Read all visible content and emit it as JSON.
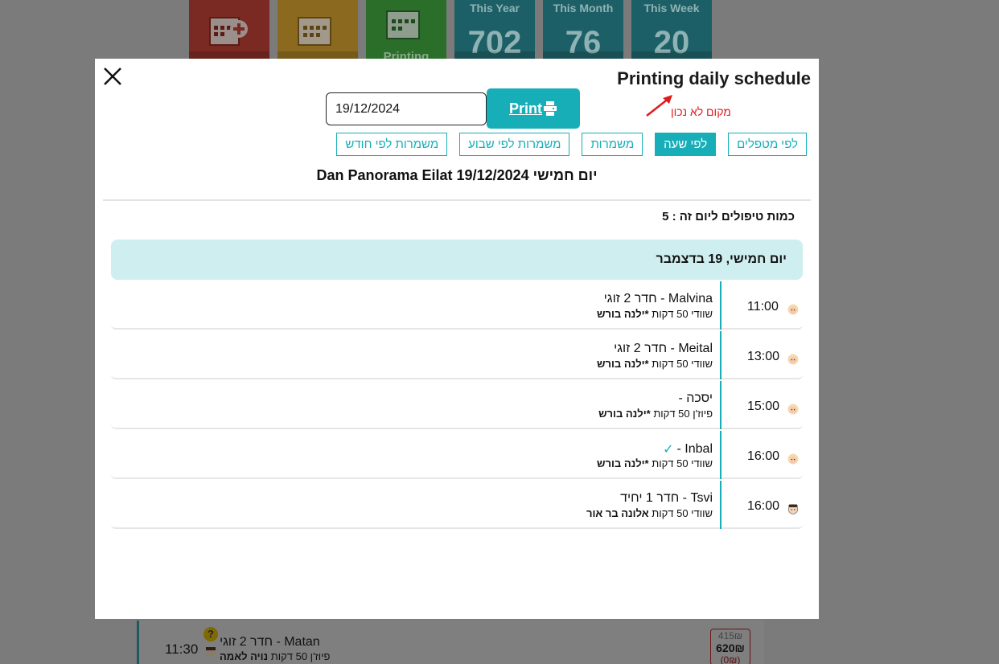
{
  "background": {
    "tiles": [
      {
        "color": "red",
        "icon": "calendar-plus-icon"
      },
      {
        "color": "orange",
        "icon": "calendar-icon"
      },
      {
        "color": "green",
        "icon": "calendar-print-icon",
        "label": "Printing"
      },
      {
        "color": "teal",
        "caption": "This Year",
        "value": "702"
      },
      {
        "color": "teal",
        "caption": "This Month",
        "value": "76"
      },
      {
        "color": "teal",
        "caption": "This Week",
        "value": "20"
      }
    ],
    "row": {
      "time": "11:30",
      "name": "Matan - חדר 2 זוגי",
      "sub_prefix": "פיוז'ן 50 דקות",
      "sub_bold": "נויה לאמה",
      "price_old": "415₪",
      "price": "620₪",
      "price_extra": "(0₪)"
    }
  },
  "modal": {
    "title": "Printing daily schedule",
    "date_value": "19/12/2024",
    "print_label": "Print",
    "annotation": "מקום לא נכון",
    "tabs": [
      "לפי מטפלים",
      "לפי שעה",
      "משמרות",
      "משמרות לפי שבוע",
      "משמרות לפי חודש"
    ],
    "active_tab": "לפי שעה",
    "schedule_title": "Dan Panorama Eilat יום חמישי 19/12/2024",
    "count_text": "כמות טיפולים ליום זה : 5",
    "day_header": "יום חמישי, 19 בדצמבר",
    "appointments": [
      {
        "time": "11:00",
        "name": "Malvina - חדר 2 זוגי",
        "sub_prefix": "שוודי 50 דקות",
        "therapist": "*ילנה בורש",
        "checked": false,
        "avatar": "female"
      },
      {
        "time": "13:00",
        "name": "Meital - חדר 2 זוגי",
        "sub_prefix": "שוודי 50 דקות",
        "therapist": "*ילנה בורש",
        "checked": false,
        "avatar": "female"
      },
      {
        "time": "15:00",
        "name": "יסכה -",
        "sub_prefix": "פיוז'ן 50 דקות",
        "therapist": "*ילנה בורש",
        "checked": false,
        "avatar": "female"
      },
      {
        "time": "16:00",
        "name": "Inbal -",
        "sub_prefix": "שוודי 50 דקות",
        "therapist": "*ילנה בורש",
        "checked": true,
        "avatar": "female"
      },
      {
        "time": "16:00",
        "name": "Tsvi - חדר 1 יחיד",
        "sub_prefix": "שוודי 50 דקות",
        "therapist": "אלונה בר אור",
        "checked": false,
        "avatar": "male"
      }
    ]
  },
  "colors": {
    "accent": "#17aeb8",
    "day_header_bg": "#cfeef0",
    "annotation": "#e01b1b"
  }
}
